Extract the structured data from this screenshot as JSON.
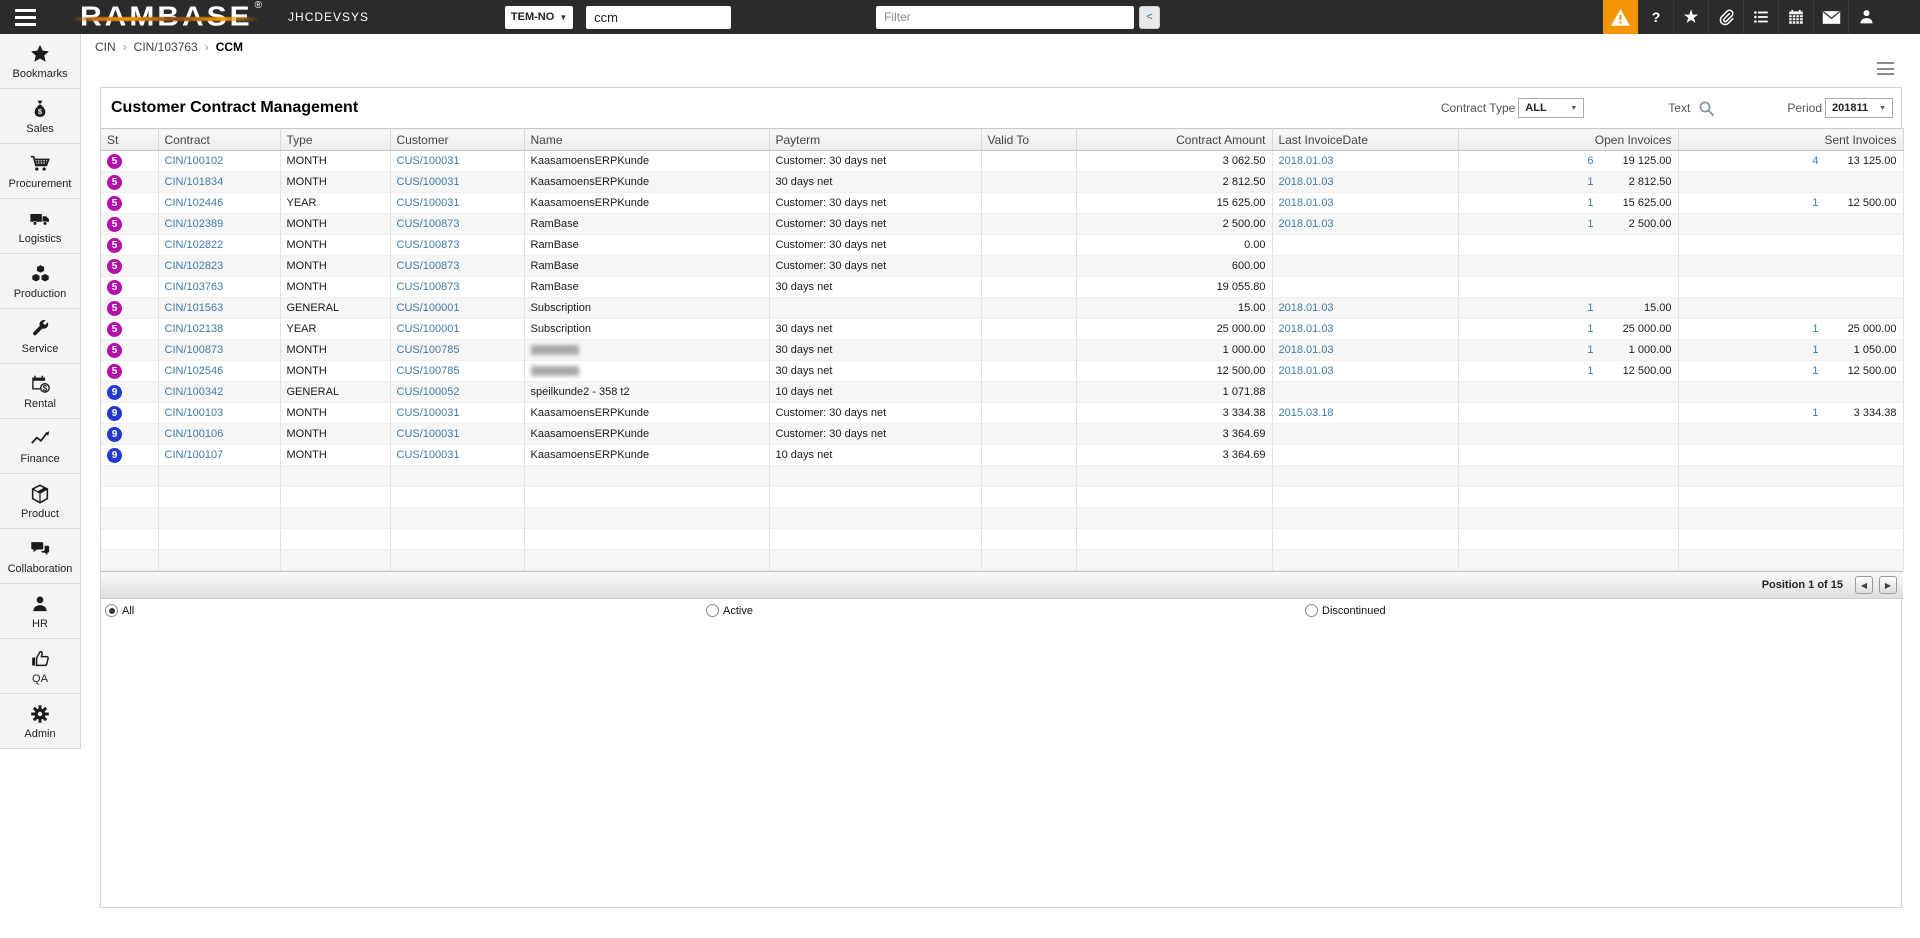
{
  "topbar": {
    "brand": "RAMBASE",
    "brand_reg": "®",
    "environment": "JHCDEVSYS",
    "module_select_value": "TEM-NO",
    "search_value": "ccm",
    "filter_placeholder": "Filter",
    "collapse_label": "<",
    "icons": [
      {
        "name": "alert-icon",
        "accent": true
      },
      {
        "name": "help-icon",
        "accent": false
      },
      {
        "name": "favorites-icon",
        "accent": false
      },
      {
        "name": "attachments-icon",
        "accent": false
      },
      {
        "name": "list-icon",
        "accent": false
      },
      {
        "name": "calendar-icon",
        "accent": false
      },
      {
        "name": "messages-icon",
        "accent": false
      },
      {
        "name": "user-icon",
        "accent": false
      }
    ]
  },
  "breadcrumb": {
    "items": [
      "CIN",
      "CIN/103763",
      "CCM"
    ],
    "separator": "›"
  },
  "sidebar": {
    "items": [
      {
        "label": "Bookmarks",
        "icon": "star-icon"
      },
      {
        "label": "Sales",
        "icon": "money-bag-icon"
      },
      {
        "label": "Procurement",
        "icon": "cart-icon"
      },
      {
        "label": "Logistics",
        "icon": "truck-icon"
      },
      {
        "label": "Production",
        "icon": "cubes-icon"
      },
      {
        "label": "Service",
        "icon": "wrench-icon"
      },
      {
        "label": "Rental",
        "icon": "rental-calendar-icon"
      },
      {
        "label": "Finance",
        "icon": "finance-chart-icon"
      },
      {
        "label": "Product",
        "icon": "product-cube-icon"
      },
      {
        "label": "Collaboration",
        "icon": "chat-bubbles-icon"
      },
      {
        "label": "HR",
        "icon": "person-icon"
      },
      {
        "label": "QA",
        "icon": "thumbs-up-icon"
      },
      {
        "label": "Admin",
        "icon": "gear-icon"
      }
    ]
  },
  "page": {
    "title": "Customer Contract Management"
  },
  "filters": {
    "contract_type_label": "Contract Type",
    "contract_type_value": "ALL",
    "text_label": "Text",
    "period_label": "Period",
    "period_value": "201811"
  },
  "table": {
    "columns": [
      "St",
      "Contract",
      "Type",
      "Customer",
      "Name",
      "Payterm",
      "Valid To",
      "Contract Amount",
      "Last InvoiceDate",
      "Open Invoices",
      "Sent Invoices"
    ],
    "empty_row_count": 5,
    "rows": [
      {
        "st": "5",
        "contract": "CIN/100102",
        "type": "MONTH",
        "customer": "CUS/100031",
        "name": "KaasamoensERPKunde",
        "blurred": false,
        "payterm": "Customer: 30 days net",
        "valid_to": "",
        "amount": "3 062.50",
        "last_invoice_date": "2018.01.03",
        "open_count": "6",
        "open_amount": "19 125.00",
        "sent_count": "4",
        "sent_amount": "13 125.00"
      },
      {
        "st": "5",
        "contract": "CIN/101834",
        "type": "MONTH",
        "customer": "CUS/100031",
        "name": "KaasamoensERPKunde",
        "blurred": false,
        "payterm": "30 days net",
        "valid_to": "",
        "amount": "2 812.50",
        "last_invoice_date": "2018.01.03",
        "open_count": "1",
        "open_amount": "2 812.50",
        "sent_count": "",
        "sent_amount": ""
      },
      {
        "st": "5",
        "contract": "CIN/102446",
        "type": "YEAR",
        "customer": "CUS/100031",
        "name": "KaasamoensERPKunde",
        "blurred": false,
        "payterm": "Customer: 30 days net",
        "valid_to": "",
        "amount": "15 625.00",
        "last_invoice_date": "2018.01.03",
        "open_count": "1",
        "open_amount": "15 625.00",
        "sent_count": "1",
        "sent_amount": "12 500.00"
      },
      {
        "st": "5",
        "contract": "CIN/102389",
        "type": "MONTH",
        "customer": "CUS/100873",
        "name": "RamBase",
        "blurred": false,
        "payterm": "Customer: 30 days net",
        "valid_to": "",
        "amount": "2 500.00",
        "last_invoice_date": "2018.01.03",
        "open_count": "1",
        "open_amount": "2 500.00",
        "sent_count": "",
        "sent_amount": ""
      },
      {
        "st": "5",
        "contract": "CIN/102822",
        "type": "MONTH",
        "customer": "CUS/100873",
        "name": "RamBase",
        "blurred": false,
        "payterm": "Customer: 30 days net",
        "valid_to": "",
        "amount": "0.00",
        "last_invoice_date": "",
        "open_count": "",
        "open_amount": "",
        "sent_count": "",
        "sent_amount": ""
      },
      {
        "st": "5",
        "contract": "CIN/102823",
        "type": "MONTH",
        "customer": "CUS/100873",
        "name": "RamBase",
        "blurred": false,
        "payterm": "Customer: 30 days net",
        "valid_to": "",
        "amount": "600.00",
        "last_invoice_date": "",
        "open_count": "",
        "open_amount": "",
        "sent_count": "",
        "sent_amount": ""
      },
      {
        "st": "5",
        "contract": "CIN/103763",
        "type": "MONTH",
        "customer": "CUS/100873",
        "name": "RamBase",
        "blurred": false,
        "payterm": "30 days net",
        "valid_to": "",
        "amount": "19 055.80",
        "last_invoice_date": "",
        "open_count": "",
        "open_amount": "",
        "sent_count": "",
        "sent_amount": ""
      },
      {
        "st": "5",
        "contract": "CIN/101563",
        "type": "GENERAL",
        "customer": "CUS/100001",
        "name": "Subscription",
        "blurred": false,
        "payterm": "",
        "valid_to": "",
        "amount": "15.00",
        "last_invoice_date": "2018.01.03",
        "open_count": "1",
        "open_amount": "15.00",
        "sent_count": "",
        "sent_amount": ""
      },
      {
        "st": "5",
        "contract": "CIN/102138",
        "type": "YEAR",
        "customer": "CUS/100001",
        "name": "Subscription",
        "blurred": false,
        "payterm": "30 days net",
        "valid_to": "",
        "amount": "25 000.00",
        "last_invoice_date": "2018.01.03",
        "open_count": "1",
        "open_amount": "25 000.00",
        "sent_count": "1",
        "sent_amount": "25 000.00"
      },
      {
        "st": "5",
        "contract": "CIN/100873",
        "type": "MONTH",
        "customer": "CUS/100785",
        "name": "",
        "blurred": true,
        "payterm": "30 days net",
        "valid_to": "",
        "amount": "1 000.00",
        "last_invoice_date": "2018.01.03",
        "open_count": "1",
        "open_amount": "1 000.00",
        "sent_count": "1",
        "sent_amount": "1 050.00"
      },
      {
        "st": "5",
        "contract": "CIN/102546",
        "type": "MONTH",
        "customer": "CUS/100785",
        "name": "",
        "blurred": true,
        "payterm": "30 days net",
        "valid_to": "",
        "amount": "12 500.00",
        "last_invoice_date": "2018.01.03",
        "open_count": "1",
        "open_amount": "12 500.00",
        "sent_count": "1",
        "sent_amount": "12 500.00"
      },
      {
        "st": "9",
        "contract": "CIN/100342",
        "type": "GENERAL",
        "customer": "CUS/100052",
        "name": "speilkunde2 - 358 t2",
        "blurred": false,
        "payterm": "10 days net",
        "valid_to": "",
        "amount": "1 071.88",
        "last_invoice_date": "",
        "open_count": "",
        "open_amount": "",
        "sent_count": "",
        "sent_amount": ""
      },
      {
        "st": "9",
        "contract": "CIN/100103",
        "type": "MONTH",
        "customer": "CUS/100031",
        "name": "KaasamoensERPKunde",
        "blurred": false,
        "payterm": "Customer: 30 days net",
        "valid_to": "",
        "amount": "3 334.38",
        "last_invoice_date": "2015.03.18",
        "open_count": "",
        "open_amount": "",
        "sent_count": "1",
        "sent_amount": "3 334.38"
      },
      {
        "st": "9",
        "contract": "CIN/100106",
        "type": "MONTH",
        "customer": "CUS/100031",
        "name": "KaasamoensERPKunde",
        "blurred": false,
        "payterm": "Customer: 30 days net",
        "valid_to": "",
        "amount": "3 364.69",
        "last_invoice_date": "",
        "open_count": "",
        "open_amount": "",
        "sent_count": "",
        "sent_amount": ""
      },
      {
        "st": "9",
        "contract": "CIN/100107",
        "type": "MONTH",
        "customer": "CUS/100031",
        "name": "KaasamoensERPKunde",
        "blurred": false,
        "payterm": "10 days net",
        "valid_to": "",
        "amount": "3 364.69",
        "last_invoice_date": "",
        "open_count": "",
        "open_amount": "",
        "sent_count": "",
        "sent_amount": ""
      }
    ]
  },
  "footer": {
    "position_text": "Position 1 of 15",
    "prev_label": "◀",
    "next_label": "▶"
  },
  "status_filters": {
    "options": [
      {
        "label": "All",
        "selected": true
      },
      {
        "label": "Active",
        "selected": false
      },
      {
        "label": "Discontinued",
        "selected": false
      }
    ]
  },
  "colors": {
    "accent_orange": "#f39500",
    "link_blue": "#3e7ca8",
    "status_active": "#b410aa",
    "status_discontinued": "#2438cd",
    "topbar_bg": "#2b2b2b"
  }
}
